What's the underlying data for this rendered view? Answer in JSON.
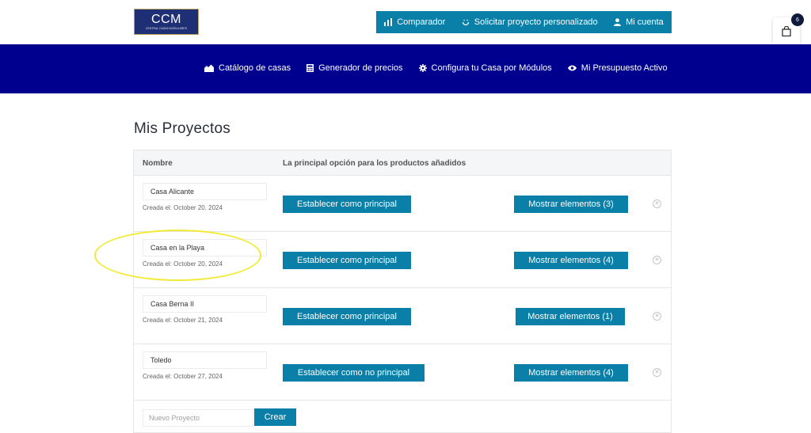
{
  "header": {
    "logo": {
      "text": "CCM",
      "subtext": "CENTRAL CASAS MODULARES"
    },
    "top_nav": [
      {
        "label": "Comparador",
        "icon": "bar-chart-icon"
      },
      {
        "label": "Solicitar proyecto personalizado",
        "icon": "smile-icon"
      },
      {
        "label": "Mi cuenta",
        "icon": "user-icon"
      }
    ],
    "cart": {
      "count": "6",
      "icon": "shopping-bag-icon"
    }
  },
  "main_nav": [
    {
      "label": "Catálogo de casas",
      "icon": "houses-icon"
    },
    {
      "label": "Generador de precios",
      "icon": "calculator-icon"
    },
    {
      "label": "Configura tu Casa por Módulos",
      "icon": "gear-icon"
    },
    {
      "label": "Mi Presupuesto Activo",
      "icon": "eye-icon"
    }
  ],
  "page": {
    "title": "Mis Proyectos",
    "table": {
      "headers": [
        "Nombre",
        "La principal opción para los productos añadidos"
      ],
      "rows": [
        {
          "name": "Casa Alicante",
          "created": "Creada el: October 20, 2024",
          "main_label": "Establecer como principal",
          "show_label": "Mostrar elementos (3)"
        },
        {
          "name": "Casa en la Playa",
          "created": "Creada el: October 20, 2024",
          "main_label": "Establecer como principal",
          "show_label": "Mostrar elementos (4)"
        },
        {
          "name": "Casa Berna II",
          "created": "Creada el: October 21, 2024",
          "main_label": "Establecer como principal",
          "show_label": "Mostrar elementos (1)"
        },
        {
          "name": "Toledo",
          "created": "Creada el: October 27, 2024",
          "main_label": "Establecer como no principal",
          "show_label": "Mostrar elementos (4)"
        }
      ],
      "remove_glyph": "✕"
    },
    "new_project": {
      "placeholder": "Nuevo Proyecto",
      "button_label": "Crear"
    }
  },
  "colors": {
    "accent": "#0a7fa8",
    "nav_bg": "#00008f",
    "highlight": "#f1eb38"
  }
}
